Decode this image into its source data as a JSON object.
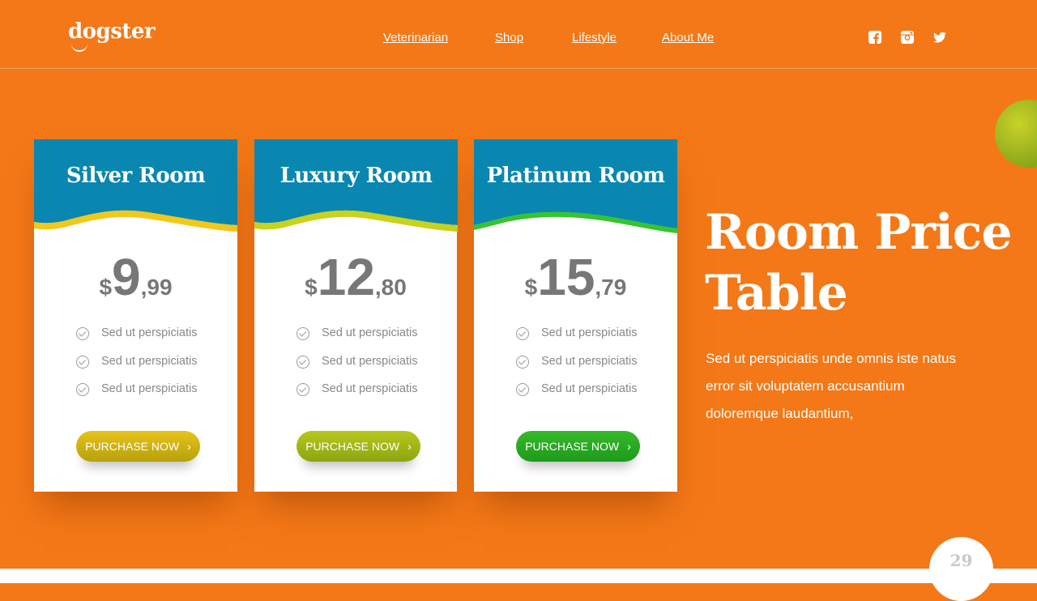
{
  "header": {
    "logo": "dogster",
    "nav": [
      {
        "label": "Veterinarian"
      },
      {
        "label": "Shop"
      },
      {
        "label": "Lifestyle"
      },
      {
        "label": "About Me"
      }
    ],
    "social": [
      "facebook-icon",
      "instagram-icon",
      "twitter-icon"
    ]
  },
  "cards": [
    {
      "title": "Silver Room",
      "currency": "$",
      "price_int": "9",
      "price_dec": ",99",
      "features": [
        "Sed ut perspiciatis",
        "Sed ut perspiciatis",
        "Sed ut perspiciatis"
      ],
      "button": "PURCHASE NOW",
      "head_color": "#0a87b0",
      "wave_color": "#f2c81c",
      "button_gradient": [
        "#e8c21b",
        "#b7a10c"
      ]
    },
    {
      "title": "Luxury Room",
      "currency": "$",
      "price_int": "12",
      "price_dec": ",80",
      "features": [
        "Sed ut perspiciatis",
        "Sed ut perspiciatis",
        "Sed ut perspiciatis"
      ],
      "button": "PURCHASE NOW",
      "head_color": "#0a87b0",
      "wave_color": "#c9d21d",
      "button_gradient": [
        "#b6c81c",
        "#8fa413"
      ]
    },
    {
      "title": "Platinum Room",
      "currency": "$",
      "price_int": "15",
      "price_dec": ",79",
      "features": [
        "Sed ut perspiciatis",
        "Sed ut perspiciatis",
        "Sed ut perspiciatis"
      ],
      "button": "PURCHASE NOW",
      "head_color": "#0a87b0",
      "wave_color": "#37c42c",
      "button_gradient": [
        "#36b92a",
        "#1e9a1c"
      ]
    }
  ],
  "heading_line1": "Room Price",
  "heading_line2": "Table",
  "description": "Sed ut perspiciatis unde omnis iste natus error sit voluptatem accusantium doloremque laudantium,",
  "page_number": "29",
  "colors": {
    "background": "#f47817",
    "accent_blue": "#0a87b0",
    "white": "#ffffff"
  }
}
